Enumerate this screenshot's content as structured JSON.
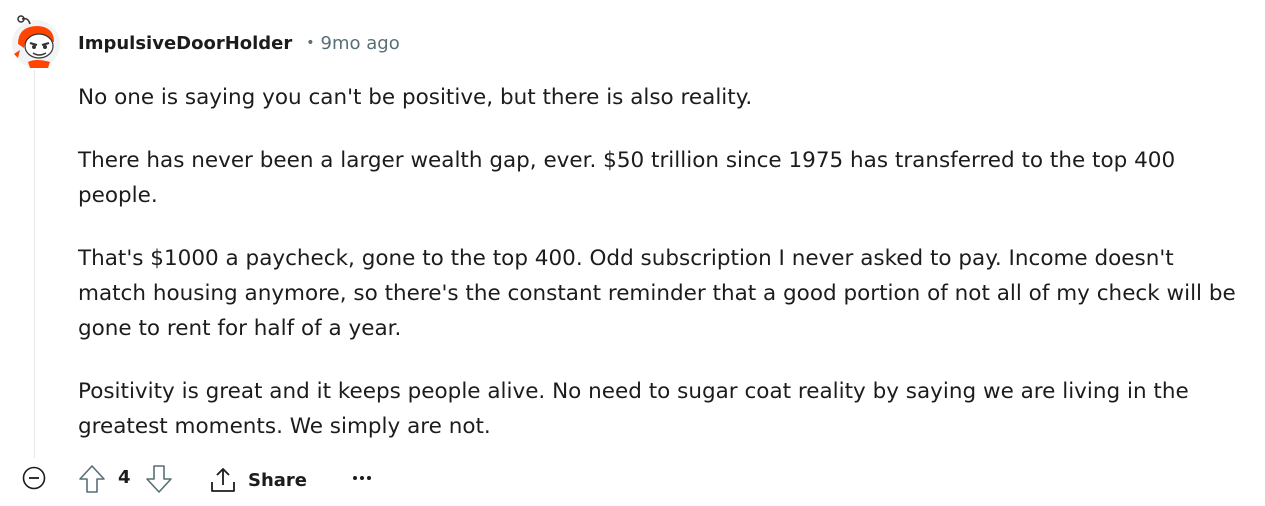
{
  "comment": {
    "author": "ImpulsiveDoorHolder",
    "separator": "•",
    "timestamp": "9mo ago",
    "paragraphs": [
      "No one is saying you can't be positive, but there is also reality.",
      "There has never been a larger wealth gap, ever. $50 trillion since 1975 has transferred to the top 400 people.",
      "That's $1000 a paycheck, gone to the top 400. Odd subscription I never asked to pay. Income doesn't match housing anymore, so there's the constant reminder that a good portion of not all of my check will be gone to rent for half of a year.",
      "Positivity is great and it keeps people alive. No need to sugar coat reality by saying we are living in the greatest moments. We simply are not."
    ]
  },
  "actions": {
    "score": "4",
    "share_label": "Share",
    "icons": [
      "collapse-icon",
      "upvote-icon",
      "downvote-icon",
      "share-icon",
      "more-options-icon"
    ]
  },
  "colors": {
    "text": "#1c1c1c",
    "meta": "#576f76",
    "avatar_accent": "#ff4500",
    "thread_line": "#e5e9ec"
  }
}
